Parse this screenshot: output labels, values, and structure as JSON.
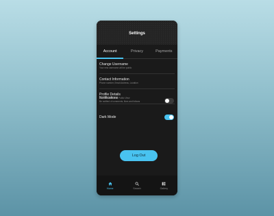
{
  "header": {
    "title": "Settings"
  },
  "tabs": [
    {
      "label": "Account",
      "active": true
    },
    {
      "label": "Privacy",
      "active": false
    },
    {
      "label": "Payments",
      "active": false
    }
  ],
  "account_items": [
    {
      "title": "Change Username",
      "subtitle": "Your new username will be public"
    },
    {
      "title": "Contact Information",
      "subtitle": "Phone number, Email Address, Location"
    },
    {
      "title": "Profile Details",
      "subtitle": "Bio, Profile Picture, Public View"
    }
  ],
  "notifications": {
    "title": "Notifications",
    "subtitle": "Be notified of comments, likes and follows",
    "enabled": false
  },
  "dark_mode": {
    "title": "Dark Mode",
    "enabled": true
  },
  "logout_label": "Log Out",
  "nav": [
    {
      "label": "Home",
      "icon": "home-icon",
      "active": true
    },
    {
      "label": "Search",
      "icon": "search-icon",
      "active": false
    },
    {
      "label": "Gallery",
      "icon": "gallery-icon",
      "active": false
    }
  ],
  "colors": {
    "accent": "#49c3f0",
    "panel": "#1a1a1a",
    "toggle_off": "#3a3a3a"
  }
}
